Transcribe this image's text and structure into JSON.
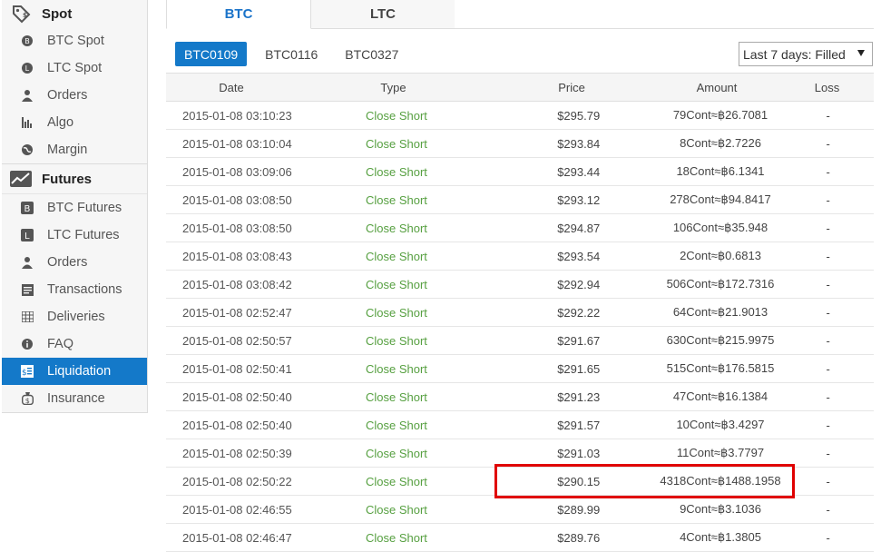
{
  "sidebar": {
    "spot": {
      "title": "Spot",
      "items": [
        {
          "label": "BTC Spot"
        },
        {
          "label": "LTC Spot"
        },
        {
          "label": "Orders"
        },
        {
          "label": "Algo"
        },
        {
          "label": "Margin"
        }
      ]
    },
    "futures": {
      "title": "Futures",
      "items": [
        {
          "label": "BTC Futures"
        },
        {
          "label": "LTC Futures"
        },
        {
          "label": "Orders"
        },
        {
          "label": "Transactions"
        },
        {
          "label": "Deliveries"
        },
        {
          "label": "FAQ"
        },
        {
          "label": "Liquidation",
          "active": true
        },
        {
          "label": "Insurance"
        }
      ]
    }
  },
  "tabs": [
    {
      "label": "BTC",
      "active": true
    },
    {
      "label": "LTC",
      "active": false
    }
  ],
  "contracts": [
    {
      "label": "BTC0109",
      "active": true
    },
    {
      "label": "BTC0116",
      "active": false
    },
    {
      "label": "BTC0327",
      "active": false
    }
  ],
  "filter": {
    "selected": "Last 7 days: Filled"
  },
  "table": {
    "columns": [
      "Date",
      "Type",
      "Price",
      "Amount",
      "Loss"
    ],
    "rows": [
      {
        "date": "2015-01-08 03:10:23",
        "type": "Close Short",
        "price": "$295.79",
        "amount": "79Cont≈฿26.7081",
        "loss": "-"
      },
      {
        "date": "2015-01-08 03:10:04",
        "type": "Close Short",
        "price": "$293.84",
        "amount": "8Cont≈฿2.7226",
        "loss": "-"
      },
      {
        "date": "2015-01-08 03:09:06",
        "type": "Close Short",
        "price": "$293.44",
        "amount": "18Cont≈฿6.1341",
        "loss": "-"
      },
      {
        "date": "2015-01-08 03:08:50",
        "type": "Close Short",
        "price": "$293.12",
        "amount": "278Cont≈฿94.8417",
        "loss": "-"
      },
      {
        "date": "2015-01-08 03:08:50",
        "type": "Close Short",
        "price": "$294.87",
        "amount": "106Cont≈฿35.948",
        "loss": "-"
      },
      {
        "date": "2015-01-08 03:08:43",
        "type": "Close Short",
        "price": "$293.54",
        "amount": "2Cont≈฿0.6813",
        "loss": "-"
      },
      {
        "date": "2015-01-08 03:08:42",
        "type": "Close Short",
        "price": "$292.94",
        "amount": "506Cont≈฿172.7316",
        "loss": "-"
      },
      {
        "date": "2015-01-08 02:52:47",
        "type": "Close Short",
        "price": "$292.22",
        "amount": "64Cont≈฿21.9013",
        "loss": "-"
      },
      {
        "date": "2015-01-08 02:50:57",
        "type": "Close Short",
        "price": "$291.67",
        "amount": "630Cont≈฿215.9975",
        "loss": "-"
      },
      {
        "date": "2015-01-08 02:50:41",
        "type": "Close Short",
        "price": "$291.65",
        "amount": "515Cont≈฿176.5815",
        "loss": "-"
      },
      {
        "date": "2015-01-08 02:50:40",
        "type": "Close Short",
        "price": "$291.23",
        "amount": "47Cont≈฿16.1384",
        "loss": "-"
      },
      {
        "date": "2015-01-08 02:50:40",
        "type": "Close Short",
        "price": "$291.57",
        "amount": "10Cont≈฿3.4297",
        "loss": "-"
      },
      {
        "date": "2015-01-08 02:50:39",
        "type": "Close Short",
        "price": "$291.03",
        "amount": "11Cont≈฿3.7797",
        "loss": "-"
      },
      {
        "date": "2015-01-08 02:50:22",
        "type": "Close Short",
        "price": "$290.15",
        "amount": "4318Cont≈฿1488.1958",
        "loss": "-"
      },
      {
        "date": "2015-01-08 02:46:55",
        "type": "Close Short",
        "price": "$289.99",
        "amount": "9Cont≈฿3.1036",
        "loss": "-"
      },
      {
        "date": "2015-01-08 02:46:47",
        "type": "Close Short",
        "price": "$289.76",
        "amount": "4Cont≈฿1.3805",
        "loss": "-"
      }
    ]
  },
  "colors": {
    "accent": "#1479c9",
    "close_short": "#57a041",
    "highlight": "#e00000"
  }
}
